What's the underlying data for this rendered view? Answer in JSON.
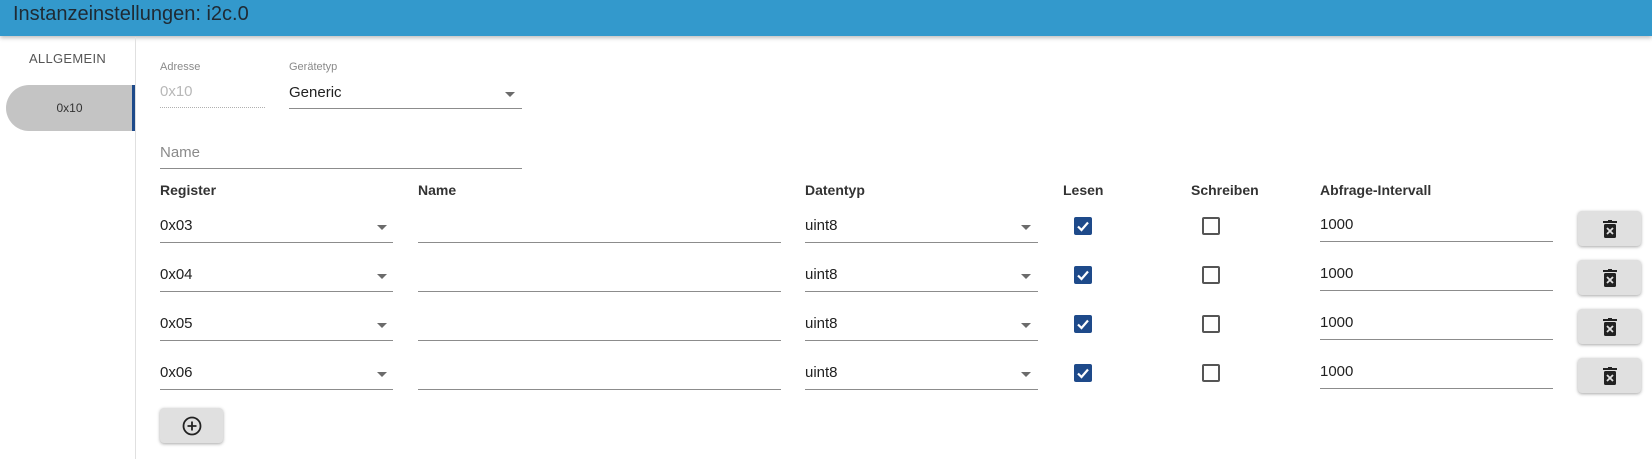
{
  "header": {
    "title": "Instanzeinstellungen: i2c.0"
  },
  "sidebar": {
    "tabs": [
      {
        "label": "ALLGEMEIN"
      },
      {
        "label": "0x10"
      }
    ]
  },
  "device": {
    "address_label": "Adresse",
    "address_value": "0x10",
    "type_label": "Gerätetyp",
    "type_value": "Generic",
    "name_placeholder": "Name"
  },
  "table": {
    "headers": {
      "register": "Register",
      "name": "Name",
      "datatype": "Datentyp",
      "read": "Lesen",
      "write": "Schreiben",
      "interval": "Abfrage-Intervall"
    },
    "rows": [
      {
        "register": "0x03",
        "name": "",
        "datatype": "uint8",
        "read": true,
        "write": false,
        "interval": "1000"
      },
      {
        "register": "0x04",
        "name": "",
        "datatype": "uint8",
        "read": true,
        "write": false,
        "interval": "1000"
      },
      {
        "register": "0x05",
        "name": "",
        "datatype": "uint8",
        "read": true,
        "write": false,
        "interval": "1000"
      },
      {
        "register": "0x06",
        "name": "",
        "datatype": "uint8",
        "read": true,
        "write": false,
        "interval": "1000"
      }
    ]
  },
  "icons": {
    "delete": "delete-forever-icon",
    "add": "add-circle-icon",
    "dropdown": "chevron-down-icon",
    "check": "check-icon"
  },
  "colors": {
    "header": "#3399cc",
    "accent": "#1e4a8a",
    "tab_selected": "#c4c4c4"
  }
}
